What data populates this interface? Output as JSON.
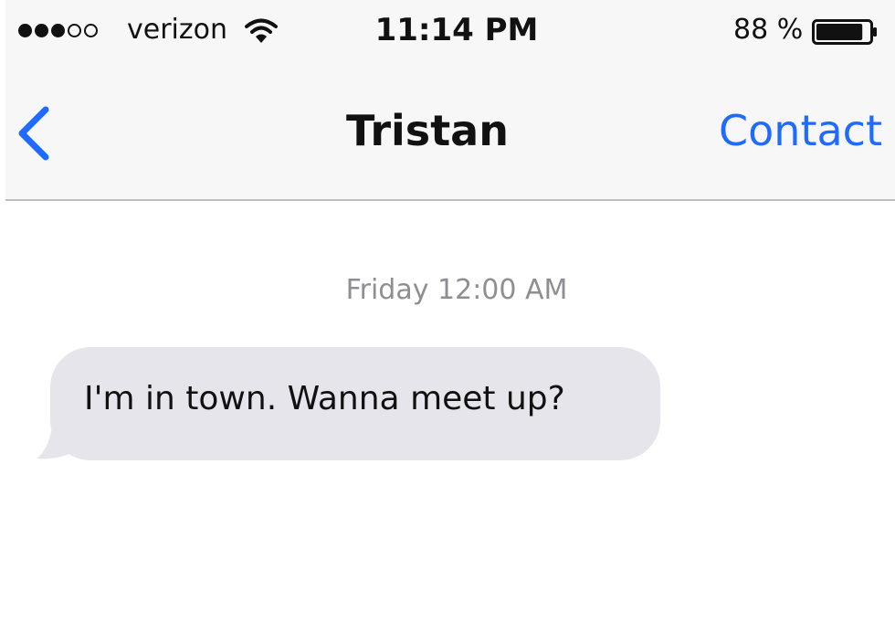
{
  "status_bar": {
    "signal_bars_filled": 3,
    "signal_bars_total": 5,
    "carrier": "verizon",
    "time": "11:14 PM",
    "battery_percent_label": "88 %",
    "battery_level": 0.88,
    "wifi_icon": "wifi-icon",
    "battery_icon": "battery-icon"
  },
  "nav_bar": {
    "back_icon": "chevron-left-icon",
    "title": "Tristan",
    "contact_label": "Contact"
  },
  "conversation": {
    "timestamp": "Friday 12:00 AM",
    "messages": [
      {
        "direction": "incoming",
        "text": "I'm in town. Wanna meet up?"
      }
    ]
  },
  "colors": {
    "accent": "#1f6bff",
    "incoming_bubble": "#e6e5eb",
    "timestamp_gray": "#8e8e93",
    "nav_background": "#f7f7f7"
  }
}
